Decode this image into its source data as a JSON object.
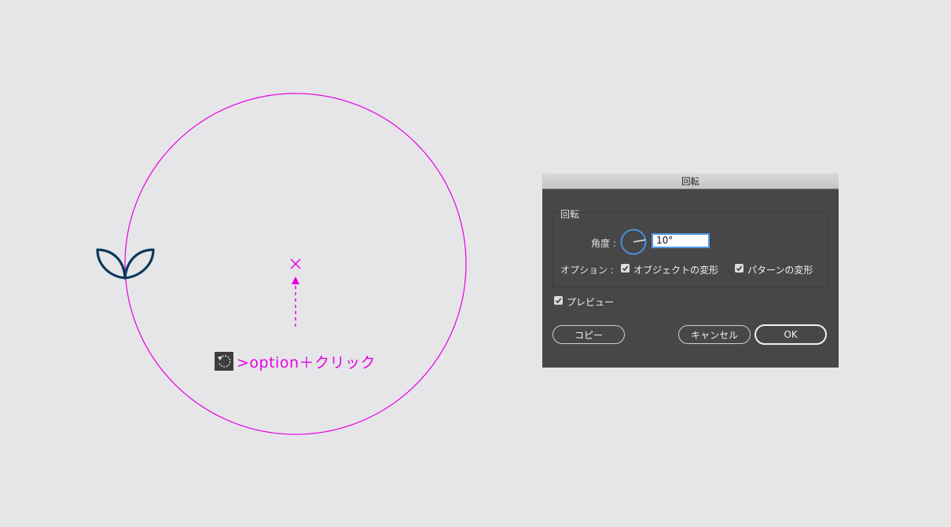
{
  "canvas": {
    "hint": {
      "tool_icon": "rotate-tool-icon",
      "text": ">option＋クリック"
    },
    "colors": {
      "guide": "#e600e6",
      "artwork": "#0b3a5c",
      "background": "#e6e6e8"
    }
  },
  "dialog": {
    "title": "回転",
    "group_label": "回転",
    "angle": {
      "label": "角度 :",
      "value": "10°",
      "dial_icon": "angle-dial-icon"
    },
    "options": {
      "label": "オプション :",
      "transform_objects": {
        "label": "オブジェクトの変形",
        "checked": true
      },
      "transform_patterns": {
        "label": "パターンの変形",
        "checked": true
      }
    },
    "preview": {
      "label": "プレビュー",
      "checked": true
    },
    "buttons": {
      "copy": "コピー",
      "cancel": "キャンセル",
      "ok": "OK"
    }
  }
}
